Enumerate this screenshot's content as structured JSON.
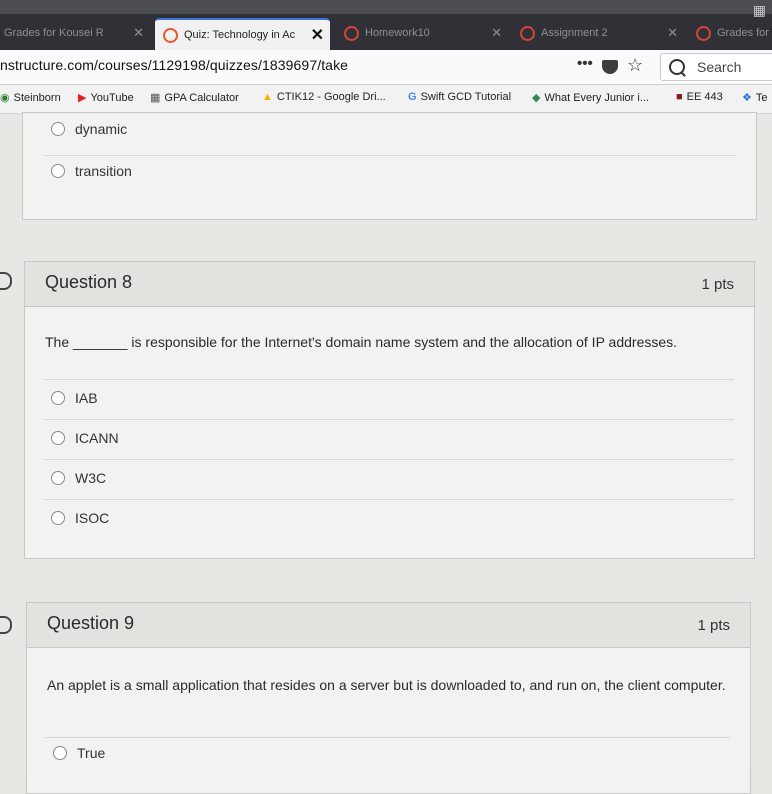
{
  "browser": {
    "tabs": [
      {
        "label": "Grades for Kousei R",
        "active": false
      },
      {
        "label": "Quiz: Technology in Ac",
        "active": true
      },
      {
        "label": "Homework10",
        "active": false
      },
      {
        "label": "Assignment 2",
        "active": false
      },
      {
        "label": "Grades for",
        "active": false
      }
    ],
    "url": "nstructure.com/courses/1129198/quizzes/1839697/take",
    "search_placeholder": "Search",
    "bookmarks": [
      {
        "label": "Steinborn",
        "icon": "globe-icon"
      },
      {
        "label": "YouTube",
        "icon": "youtube-icon"
      },
      {
        "label": "GPA Calculator",
        "icon": "calculator-icon"
      },
      {
        "label": "CTIK12 - Google Dri...",
        "icon": "drive-icon"
      },
      {
        "label": "Swift GCD Tutorial",
        "icon": "google-icon"
      },
      {
        "label": "What Every Junior i...",
        "icon": "site-icon"
      },
      {
        "label": "EE 443",
        "icon": "site-icon"
      },
      {
        "label": "Te",
        "icon": "dropbox-icon"
      }
    ]
  },
  "previous_question": {
    "answers": [
      "dynamic",
      "transition"
    ]
  },
  "question8": {
    "title": "Question 8",
    "points": "1 pts",
    "text_before": "The",
    "blank": "_______",
    "text_after": "is responsible for the Internet's domain name system and the allocation of IP addresses.",
    "answers": [
      "IAB",
      "ICANN",
      "W3C",
      "ISOC"
    ]
  },
  "question9": {
    "title": "Question 9",
    "points": "1 pts",
    "text": "An applet is a small application that resides on a server but is downloaded to, and run on, the client computer.",
    "answers": [
      "True"
    ]
  }
}
